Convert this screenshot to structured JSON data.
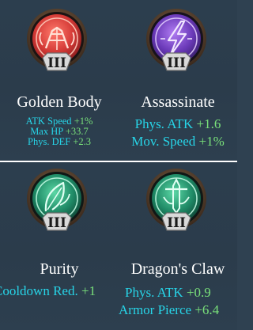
{
  "skills": [
    {
      "name": "Golden Body",
      "icon": "fist-icon",
      "rank": "III",
      "theme": "#e0413f",
      "stats": [
        {
          "label": "ATK Speed",
          "value": "+1%"
        },
        {
          "label": "Max HP",
          "value": "+33.7"
        },
        {
          "label": "Phys. DEF",
          "value": "+2.3"
        }
      ]
    },
    {
      "name": "Assassinate",
      "icon": "lightning-icon",
      "rank": "III",
      "theme": "#8f55e6",
      "stats": [
        {
          "label": "Phys. ATK",
          "value": "+1.6"
        },
        {
          "label": "Mov. Speed",
          "value": "+1%"
        }
      ]
    },
    {
      "name": "Purity",
      "icon": "leaf-icon",
      "rank": "III",
      "theme": "#27b38a",
      "stats": [
        {
          "label": "Cooldown Red.",
          "value": "+1"
        }
      ]
    },
    {
      "name": "Dragon's Claw",
      "icon": "sword-icon",
      "rank": "III",
      "theme": "#27b38a",
      "stats": [
        {
          "label": "Phys. ATK",
          "value": "+0.9"
        },
        {
          "label": "Armor Pierce",
          "value": "+6.4"
        }
      ]
    }
  ],
  "colors": {
    "background": "#2c3e4e",
    "stat_label": "#27d5e8",
    "stat_value": "#79e07a",
    "skill_name": "#ffffff",
    "rank_badge": "#d8d8d8"
  }
}
